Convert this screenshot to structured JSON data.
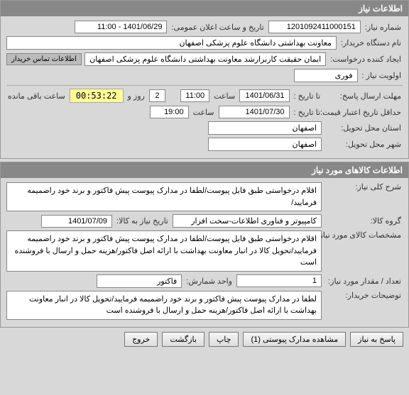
{
  "section1": {
    "header": "اطلاعات نیاز",
    "need_no_label": "شماره نیاز:",
    "need_no": "1201092411000151",
    "announce_label": "تاریخ و ساعت اعلان عمومی:",
    "announce_value": "1401/06/29 - 11:00",
    "buyer_org_label": "نام دستگاه خریدار:",
    "buyer_org": "معاونت بهداشتی دانشگاه علوم پزشکی اصفهان",
    "requester_label": "ایجاد کننده درخواست:",
    "requester": "ایمان حقیقت کاربرارشد معاونت بهداشتی دانشگاه علوم پزشکی اصفهان",
    "contact_btn": "اطلاعات تماس خریدار",
    "priority_label": "اولویت نیاز :",
    "priority": "فوری",
    "deadline_label": "مهلت ارسال پاسخ:",
    "to_date_label": "تا تاریخ :",
    "deadline_date": "1401/06/31",
    "time_label": "ساعت",
    "deadline_time": "11:00",
    "days": "2",
    "days_label": "روز و",
    "countdown": "00:53:22",
    "remain_label": "ساعت باقی مانده",
    "validity_label": "حداقل تاریخ اعتبار قیمت:",
    "validity_date": "1401/07/30",
    "validity_time": "19:00",
    "province_label": "استان محل تحویل:",
    "province": "اصفهان",
    "city_label": "شهر محل تحویل:",
    "city": "اصفهان"
  },
  "section2": {
    "header": "اطلاعات کالاهای مورد نیاز",
    "desc_label": "شرح کلی نیاز:",
    "desc": "اقلام درخواستی طبق فایل پیوست/لطفا در مدارک پیوست پیش فاکتور و برند خود راضمیمه فرمایید/",
    "group_label": "گروه کالا:",
    "group": "کامپیوتر و فناوری اطلاعات-سخت افزار",
    "need_date_label": "تاریخ نیاز به کالا:",
    "need_date": "1401/07/09",
    "spec_label": "مشخصات کالای مورد نیاز:",
    "spec": "اقلام درخواستی طبق فایل پیوست/لطفا در مدارک پیوست پیش فاکتور و برند خود راضمیمه فرمایید/تحویل کالا در انبار معاونت بهداشت با ارائه اصل فاکتور/هزینه حمل و ارسال با فروشنده است",
    "qty_label": "تعداد / مقدار مورد نیاز:",
    "qty": "1",
    "unit_label": "واحد شمارش:",
    "unit": "فاکتور",
    "buyer_notes_label": "توضیحات خریدار:",
    "buyer_notes": "لطفا در مدارک پیوست پیش فاکتور و برند خود راضمیمه فرمایید/تحویل کالا در انبار معاونت بهداشت با ارائه اصل فاکتور/هزینه حمل و ارسال با فروشنده است"
  },
  "buttons": {
    "reply": "پاسخ به نیاز",
    "attachments": "مشاهده مدارک پیوستی (1)",
    "print": "چاپ",
    "back": "بازگشت",
    "exit": "خروج"
  }
}
